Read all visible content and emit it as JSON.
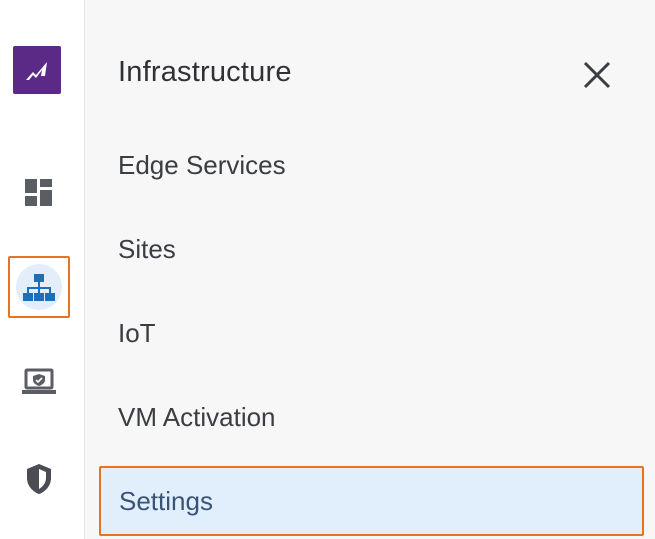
{
  "rail": {
    "items": [
      {
        "name": "dashboard",
        "icon": "dashboard-icon"
      },
      {
        "name": "infrastructure",
        "icon": "network-tree-icon",
        "active": true
      },
      {
        "name": "monitor",
        "icon": "laptop-shield-icon"
      },
      {
        "name": "security",
        "icon": "shield-icon"
      }
    ],
    "logo": "brand-logo-icon"
  },
  "panel": {
    "title": "Infrastructure",
    "close_icon": "close-icon",
    "items": [
      {
        "label": "Edge Services"
      },
      {
        "label": "Sites"
      },
      {
        "label": "IoT"
      },
      {
        "label": "VM Activation"
      },
      {
        "label": "Settings",
        "selected": true
      }
    ]
  },
  "colors": {
    "brand": "#5b2a86",
    "highlight_border": "#e8731f",
    "active_icon": "#1f6fb8",
    "selected_bg": "#e1eefb"
  }
}
